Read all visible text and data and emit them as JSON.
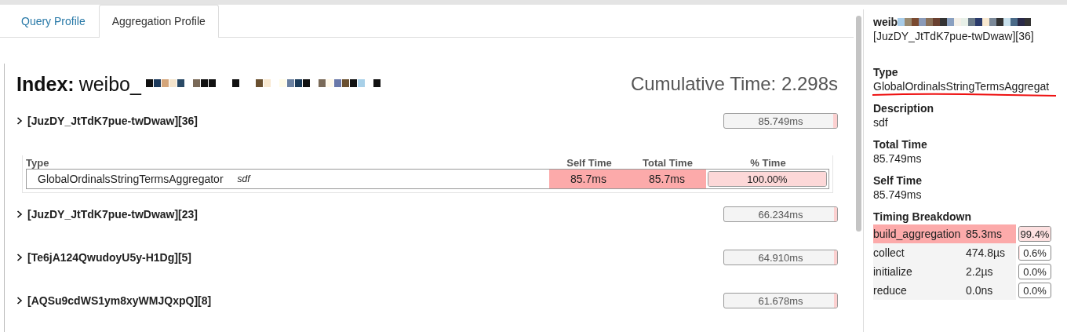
{
  "tabs": [
    {
      "label": "Query Profile",
      "selected": false
    },
    {
      "label": "Aggregation Profile",
      "selected": true
    }
  ],
  "index": {
    "label": "Index:",
    "name": "weibo_"
  },
  "cumulative_time": "Cumulative Time: 2.298s",
  "aggregations": [
    {
      "name": "[JuzDY_JtTdK7pue-twDwaw][36]",
      "time": "85.749ms",
      "level": 0.037,
      "table": {
        "columns": [
          "Type",
          "Self Time",
          "Total Time",
          "% Time"
        ],
        "rows": [
          {
            "type": "GlobalOrdinalsStringTermsAggregator",
            "description": "sdf",
            "self_time": "85.7ms",
            "total_time": "85.7ms",
            "percent": "100.00%",
            "level": 1
          }
        ]
      }
    },
    {
      "name": "[JuzDY_JtTdK7pue-twDwaw][23]",
      "time": "66.234ms",
      "level": 0.029
    },
    {
      "name": "[Te6jA124QwudoyU5y-H1Dg][5]",
      "time": "64.910ms",
      "level": 0.028
    },
    {
      "name": "[AQSu9cdWS1ym8xyWMJQxpQ][8]",
      "time": "61.678ms",
      "level": 0.027
    }
  ],
  "details": {
    "title": "weib",
    "subtitle": "[JuzDY_JtTdK7pue-twDwaw][36]",
    "fields": [
      {
        "label": "Type",
        "value": "GlobalOrdinalsStringTermsAggregat",
        "underlined": true
      },
      {
        "label": "Description",
        "value": "sdf",
        "underlined": false
      },
      {
        "label": "Total Time",
        "value": "85.749ms",
        "underlined": false
      },
      {
        "label": "Self Time",
        "value": "85.749ms",
        "underlined": false
      }
    ],
    "breakdown": {
      "title": "Timing Breakdown",
      "rows": [
        {
          "name": "build_aggregation",
          "time": "85.3ms",
          "percent": "99.4%",
          "level": 0.994,
          "highlighted": true
        },
        {
          "name": "collect",
          "time": "474.8µs",
          "percent": "0.6%",
          "level": 0.006,
          "highlighted": false
        },
        {
          "name": "initialize",
          "time": "2.2µs",
          "percent": "0.0%",
          "level": 0,
          "highlighted": false
        },
        {
          "name": "reduce",
          "time": "0.0ns",
          "percent": "0.0%",
          "level": 0,
          "highlighted": false
        }
      ]
    }
  }
}
